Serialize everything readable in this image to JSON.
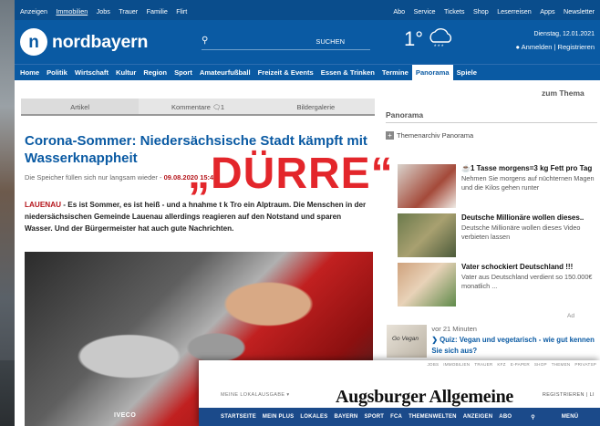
{
  "topbar": {
    "left": [
      "Anzeigen",
      "Immobilien",
      "Jobs",
      "Trauer",
      "Familie",
      "Flirt"
    ],
    "right": [
      "Abo",
      "Service",
      "Tickets",
      "Shop",
      "Leserreisen",
      "Apps",
      "Newsletter"
    ]
  },
  "header": {
    "logo_mark": "n",
    "logo_text": "nordbayern",
    "search_button": "SUCHEN",
    "temperature": "1°",
    "date": "Dienstag, 12.01.2021",
    "account": "Anmelden | Registrieren"
  },
  "nav": {
    "items": [
      "Home",
      "Politik",
      "Wirtschaft",
      "Kultur",
      "Region",
      "Sport",
      "Amateurfußball",
      "Freizeit & Events",
      "Essen & Trinken",
      "Termine",
      "Panorama",
      "Spiele"
    ],
    "active": "Panorama"
  },
  "zum_thema": "zum Thema",
  "tabs": {
    "artikel": "Artikel",
    "kommentare": "Kommentare",
    "comment_count": "1",
    "bildergalerie": "Bildergalerie"
  },
  "article": {
    "headline": "Corona-Sommer: Niedersächsische Stadt kämpft mit Wasserknappheit",
    "subline_text": "Die Speicher füllen sich nur langsam wieder - ",
    "subline_date": "09.08.2020 15:4",
    "subline_rest": "hr",
    "place": "LAUENAU",
    "teaser_line1": " - Es ist Sommer, es ist heiß - und a",
    "teaser_gap": "hnahme",
    "teaser_line1b": "t k",
    "teaser_line1c": "Tro",
    "teaser_line1d": "ein",
    "teaser_rest": "Alptraum. Die Menschen in der niedersächsischen Gemeinde Lauenau allerdings reagieren auf den Notstand und sparen Wasser. Und der Bürgermeister hat auch gute Nachrichten.",
    "photo_brand": "IVECO"
  },
  "overlay_word": "„DÜRRE“",
  "sidebar": {
    "heading": "Panorama",
    "archiv": "Themenarchiv Panorama",
    "ads": [
      {
        "title": "1 Tasse morgens=3 kg Fett pro Tag",
        "desc": "Nehmen Sie morgens auf nüchternen Magen und die Kilos gehen runter",
        "color1": "#d9d3cc",
        "color2": "#a44a3a"
      },
      {
        "title": "Deutsche Millionäre wollen dieses..",
        "desc": "Deutsche Millionäre wollen dieses Video verbieten lassen",
        "color1": "#6b7a4c",
        "color2": "#a8a070"
      },
      {
        "title": "Vater schockiert Deutschland !!!",
        "desc": "Vater aus Deutschland verdient so 150.000€ monatlich ...",
        "color1": "#cfa27d",
        "color2": "#5f8a4a"
      }
    ],
    "ad_label": "Ad",
    "quiz_time": "vor 21 Minuten",
    "quiz_title": "Quiz: Vegan und vegetarisch - wie gut kennen Sie sich aus?",
    "quiz_img_text": "Go Vegan"
  },
  "aa": {
    "top": [
      "JOBS",
      "IMMOBILIEN",
      "TRAUER",
      "KFZ",
      "E-PAPER",
      "SHOP",
      "THEMEN",
      "PRIVATSP"
    ],
    "lokal": "MEINE LOKALAUSGABE",
    "title": "Augsburger Allgemeine",
    "login": "REGISTRIEREN | LI",
    "nav": [
      "STARTSEITE",
      "MEIN PLUS",
      "LOKALES",
      "BAYERN",
      "SPORT",
      "FCA",
      "THEMENWELTEN",
      "ANZEIGEN",
      "ABO"
    ],
    "menu": "MENÜ"
  },
  "colors": {
    "brand_blue": "#0a5aa3",
    "alert_red": "#e3262b",
    "aa_blue": "#1b4a8a"
  }
}
